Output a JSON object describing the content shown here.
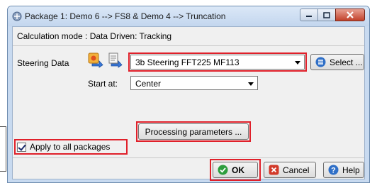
{
  "window": {
    "title": "Package 1: Demo 6 --> FS8 & Demo 4 --> Truncation",
    "minimize_icon": "minimize-icon",
    "maximize_icon": "maximize-icon",
    "close_icon": "close-icon"
  },
  "calculation_mode": "Calculation mode : Data Driven: Tracking",
  "steering": {
    "label": "Steering Data",
    "selected": "3b Steering FFT225 MF113",
    "select_button": "Select ...",
    "icons": [
      "steering-data-import-icon",
      "steering-data-file-icon"
    ]
  },
  "start_at": {
    "label": "Start at:",
    "selected": "Center"
  },
  "processing_button": "Processing parameters ...",
  "apply_all": {
    "label": "Apply to all packages",
    "checked": true
  },
  "buttons": {
    "ok": "OK",
    "cancel": "Cancel",
    "help": "Help"
  },
  "colors": {
    "highlight": "#e0202a",
    "ok_icon": "#2e9e3e",
    "cancel_icon": "#d23a2a",
    "help_icon": "#2f6fc7"
  }
}
